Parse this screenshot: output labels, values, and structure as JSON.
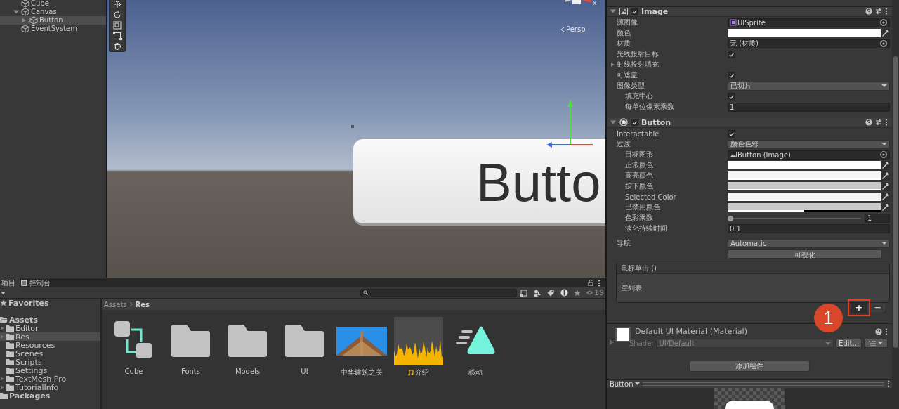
{
  "hierarchy": {
    "items": [
      {
        "label": "Cube",
        "selected": false
      },
      {
        "label": "Canvas",
        "selected": false,
        "expanded": true,
        "children": [
          {
            "label": "Button",
            "selected": true,
            "expanded": false
          }
        ]
      },
      {
        "label": "EventSystem",
        "selected": false
      }
    ]
  },
  "scene": {
    "axis_label": "x",
    "view_mode": "Persp",
    "object_text": "Butto"
  },
  "inspector": {
    "components": [
      {
        "kind": "image_component",
        "title": "Image",
        "enabled": true,
        "expanded": true,
        "properties": [
          {
            "kind": "sprite_ref",
            "label": "源图像",
            "value": "UISprite"
          },
          {
            "kind": "color",
            "label": "颜色",
            "color": "#ffffff",
            "level": 1
          },
          {
            "kind": "object",
            "label": "材质",
            "value": "无 (材质)"
          },
          {
            "kind": "checkbox",
            "label": "光线投射目标",
            "checked": true
          },
          {
            "kind": "foldout",
            "label": "射线投射填充",
            "expanded": false
          },
          {
            "kind": "checkbox",
            "label": "可遮盖",
            "checked": true
          },
          {
            "kind": "dropdown",
            "label": "图像类型",
            "value": "已切片",
            "children": [
              {
                "kind": "checkbox",
                "label": "填充中心",
                "checked": true
              },
              {
                "kind": "number",
                "label": "每单位像素乘数",
                "value": "1"
              }
            ]
          }
        ]
      },
      {
        "kind": "button_component",
        "title": "Button",
        "enabled": true,
        "expanded": true,
        "properties": [
          {
            "kind": "checkbox",
            "label": "Interactable",
            "checked": true
          },
          {
            "kind": "dropdown",
            "label": "过渡",
            "value": "颜色色彩",
            "children": [
              {
                "kind": "image_ref",
                "label": "目标图形",
                "value": "Button (Image)"
              },
              {
                "kind": "color",
                "label": "正常颜色",
                "color": "#ffffff",
                "level": 1
              },
              {
                "kind": "color",
                "label": "高亮颜色",
                "color": "#f5f5f5",
                "level": 1
              },
              {
                "kind": "color",
                "label": "按下颜色",
                "color": "#c8c8c8",
                "level": 1
              },
              {
                "kind": "color",
                "label": "Selected Color",
                "color": "#f5f5f5",
                "level": 1
              },
              {
                "kind": "color",
                "label": "已禁用颜色",
                "color": "#c8c8c8",
                "level": 0.5
              },
              {
                "kind": "slider",
                "label": "色彩乘数",
                "level": 0,
                "value": "1"
              },
              {
                "kind": "number",
                "label": "淡化持续时间",
                "value": "0.1"
              }
            ]
          },
          {
            "kind": "dropdown",
            "label": "导航",
            "value": "Automatic"
          },
          {
            "kind": "button",
            "text": "可视化"
          },
          {
            "kind": "event",
            "label": "鼠标单击 ()",
            "empty_text": "空列表",
            "add": "+",
            "remove": "−"
          }
        ]
      },
      {
        "kind": "material",
        "title": "Default UI Material (Material)",
        "shader_label": "Shader",
        "shader": "UI/Default",
        "edit_button": "Edit..."
      }
    ],
    "add_component": "添加组件",
    "preview_title": "Button"
  },
  "annotation": {
    "number": "1"
  },
  "project": {
    "tabs": [
      {
        "label": "项目",
        "selected": true
      },
      {
        "label": "控制台",
        "selected": false
      }
    ],
    "hidden_count": "19",
    "tree": [
      {
        "kind": "favorites",
        "label": "Favorites",
        "selected": false
      },
      {
        "kind": "root",
        "label": "Assets",
        "selected": false,
        "expanded": true,
        "children": [
          {
            "label": "Editor",
            "selected": false,
            "expanded": false
          },
          {
            "label": "Res",
            "selected": true,
            "expanded": false
          },
          {
            "label": "Resources",
            "selected": false
          },
          {
            "label": "Scenes",
            "selected": false
          },
          {
            "label": "Scripts",
            "selected": false
          },
          {
            "label": "Settings",
            "selected": false
          },
          {
            "label": "TextMesh Pro",
            "selected": false,
            "expanded": false
          },
          {
            "label": "TutorialInfo",
            "selected": false,
            "expanded": false
          }
        ]
      },
      {
        "kind": "root",
        "label": "Packages",
        "selected": false
      }
    ],
    "breadcrumb": [
      "Assets",
      "Res"
    ],
    "assets": [
      {
        "kind": "prefab",
        "label": "Cube"
      },
      {
        "kind": "folder",
        "label": "Fonts"
      },
      {
        "kind": "folder",
        "label": "Models"
      },
      {
        "kind": "folder",
        "label": "UI"
      },
      {
        "kind": "image",
        "label": "中华建筑之美"
      },
      {
        "kind": "audio",
        "label": "介绍"
      },
      {
        "kind": "animation",
        "label": "移动"
      }
    ]
  }
}
